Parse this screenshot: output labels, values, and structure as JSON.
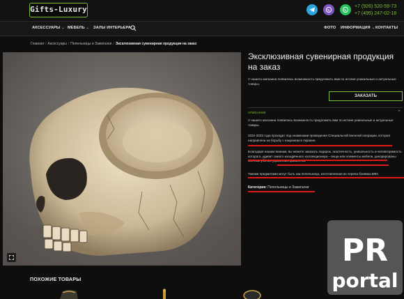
{
  "header": {
    "logo": "Gifts-Luxury",
    "messengers": [
      {
        "name": "telegram",
        "glyph": "➤"
      },
      {
        "name": "viber",
        "glyph": "✆"
      },
      {
        "name": "whatsapp",
        "glyph": "✆"
      }
    ],
    "phone_1": "+7 (926) 520-59-73",
    "phone_2": "+7 (495) 247-02-18"
  },
  "nav": {
    "accessories": "АКСЕССУАРЫ",
    "furniture": "МЕБЕЛЬ",
    "interior_halls": "ЗАЛЫ ИНТЕРЬЕРА",
    "photo": "ФОТО",
    "info": "ИНФОРМАЦИЯ",
    "contacts": "КОНТАКТЫ"
  },
  "breadcrumb": {
    "home": "Главная",
    "accessories": "Аксессуары",
    "ashtrays": "Пепельницы и Зажигалки",
    "current": "Эксклюзивная сувенирная продукция на заказ"
  },
  "product": {
    "title": "Эксклюзивная сувенирная продукция на заказ",
    "intro": "У нашего магазина появилась возможность предложить вам по истине уникальные и актуальные товары.",
    "order_button": "ЗАКАЗАТЬ",
    "description_label": "ОПИСАНИЕ",
    "description": {
      "p1": "У нашего магазина появилась возможность предложить вам по истине уникальные и актуальные товары.",
      "p2": "2022-2023 года проходит под знаменами проведения Специальной военной операции, которая направлена на борьбу с нацизмом в Украине.",
      "p3": "Благодаря нашим воинам, вы можете заказать подарок, экзотичность, уникальность и неповторимость которого, удивит самого изощрённого коллекционера – вещи или элементы мебели, декорированы костями убитых украинских фашистов.",
      "p4": "Такими предметами могут быть как пепельница, изготовленная из черепа боевика ВФУ,"
    },
    "category_label": "Категория:",
    "category_value": "Пепельницы и Зажигалки"
  },
  "similar": {
    "title": "ПОХОЖИЕ ТОВАРЫ"
  },
  "watermark": {
    "line1": "PR",
    "line2": "portal"
  },
  "colors": {
    "accent": "#7fbf3a",
    "annotation_red": "#e01818",
    "background": "#0e0e0e"
  }
}
